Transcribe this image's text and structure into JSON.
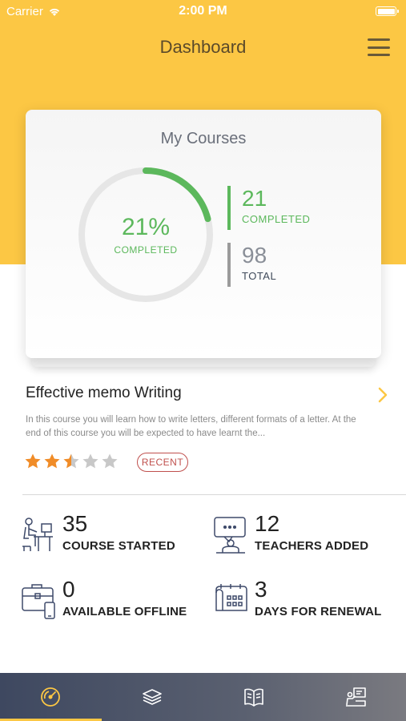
{
  "status_bar": {
    "carrier": "Carrier",
    "time": "2:00 PM"
  },
  "header": {
    "title": "Dashboard",
    "menu_icon": "hamburger-menu-icon"
  },
  "courses_card": {
    "title": "My Courses",
    "progress_fraction": 0.21,
    "percent_text": "21%",
    "percent_label": "COMPLETED",
    "completed_value": "21",
    "completed_label": "COMPLETED",
    "total_value": "98",
    "total_label": "TOTAL"
  },
  "recent_course": {
    "title": "Effective memo Writing",
    "description": "In this course you will learn how to write letters, different formats of a letter. At the end of this course you will be expected to have learnt the...",
    "rating": 2.5,
    "rating_max": 5,
    "badge": "RECENT"
  },
  "stats": [
    {
      "icon": "student-desk-icon",
      "value": "35",
      "label": "COURSE STARTED"
    },
    {
      "icon": "teacher-board-icon",
      "value": "12",
      "label": "TEACHERS ADDED"
    },
    {
      "icon": "briefcase-phone-icon",
      "value": "0",
      "label": "AVAILABLE OFFLINE"
    },
    {
      "icon": "calendar-icon",
      "value": "3",
      "label": "DAYS FOR RENEWAL"
    }
  ],
  "tabs": [
    {
      "icon": "dashboard-gauge-icon",
      "active": true
    },
    {
      "icon": "layers-icon",
      "active": false
    },
    {
      "icon": "book-icon",
      "active": false
    },
    {
      "icon": "presentation-icon",
      "active": false
    }
  ],
  "colors": {
    "accent": "#FCC744",
    "success": "#5cb85c",
    "star": "#F08C28",
    "badge": "#c0504d",
    "tabbar": "#3e4860"
  }
}
